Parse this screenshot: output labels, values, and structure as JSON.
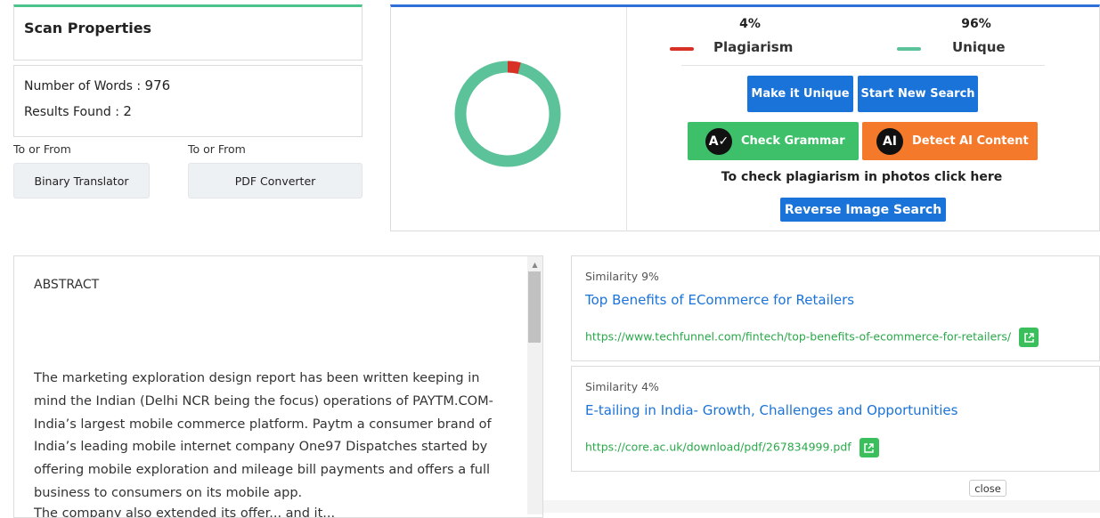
{
  "scan": {
    "title": "Scan Properties",
    "words_label": "Number of Words : ",
    "words_value": "976",
    "results_label": "Results Found : ",
    "results_value": "2"
  },
  "tools": [
    {
      "caption": "To or From",
      "label": "Binary Translator"
    },
    {
      "caption": "To or From",
      "label": "PDF Converter"
    }
  ],
  "summary": {
    "plagiarism_pct": "4%",
    "plagiarism_label": "Plagiarism",
    "unique_pct": "96%",
    "unique_label": "Unique",
    "plagiarism_fraction": 0.04,
    "plagiarism_color": "#d93025",
    "unique_color": "#5cc29a"
  },
  "actions": {
    "make_unique": "Make it Unique",
    "new_search": "Start New Search",
    "check_grammar": "Check Grammar",
    "detect_ai": "Detect AI Content",
    "photo_text": "To check plagiarism in photos click here",
    "reverse_image": "Reverse Image Search"
  },
  "colors": {
    "accent_blue": "#1a73d8",
    "grammar_green": "#3ebf6a",
    "ai_orange": "#f5792a"
  },
  "icons": {
    "grammar": "grammar-check-icon",
    "ai": "ai-detect-icon",
    "external": "external-link-icon"
  },
  "document": {
    "heading": "ABSTRACT",
    "body": "The marketing exploration design report has been written keeping in mind the Indian (Delhi NCR being the focus) operations of PAYTM.COM- India’s largest mobile commerce platform. Paytm a consumer brand of India’s leading mobile internet company One97 Dispatches started by offering mobile exploration and mileage bill payments and offers a full business to consumers on its mobile app.",
    "cut_line": "The company also extended its offer...   and it..."
  },
  "sources": [
    {
      "similarity": "Similarity 9%",
      "title": "Top Benefits of ECommerce for Retailers",
      "url": "https://www.techfunnel.com/fintech/top-benefits-of-ecommerce-for-retailers/"
    },
    {
      "similarity": "Similarity 4%",
      "title": "E-tailing in India- Growth, Challenges and Opportunities",
      "url": "https://core.ac.uk/download/pdf/267834999.pdf"
    }
  ],
  "close_label": "close"
}
